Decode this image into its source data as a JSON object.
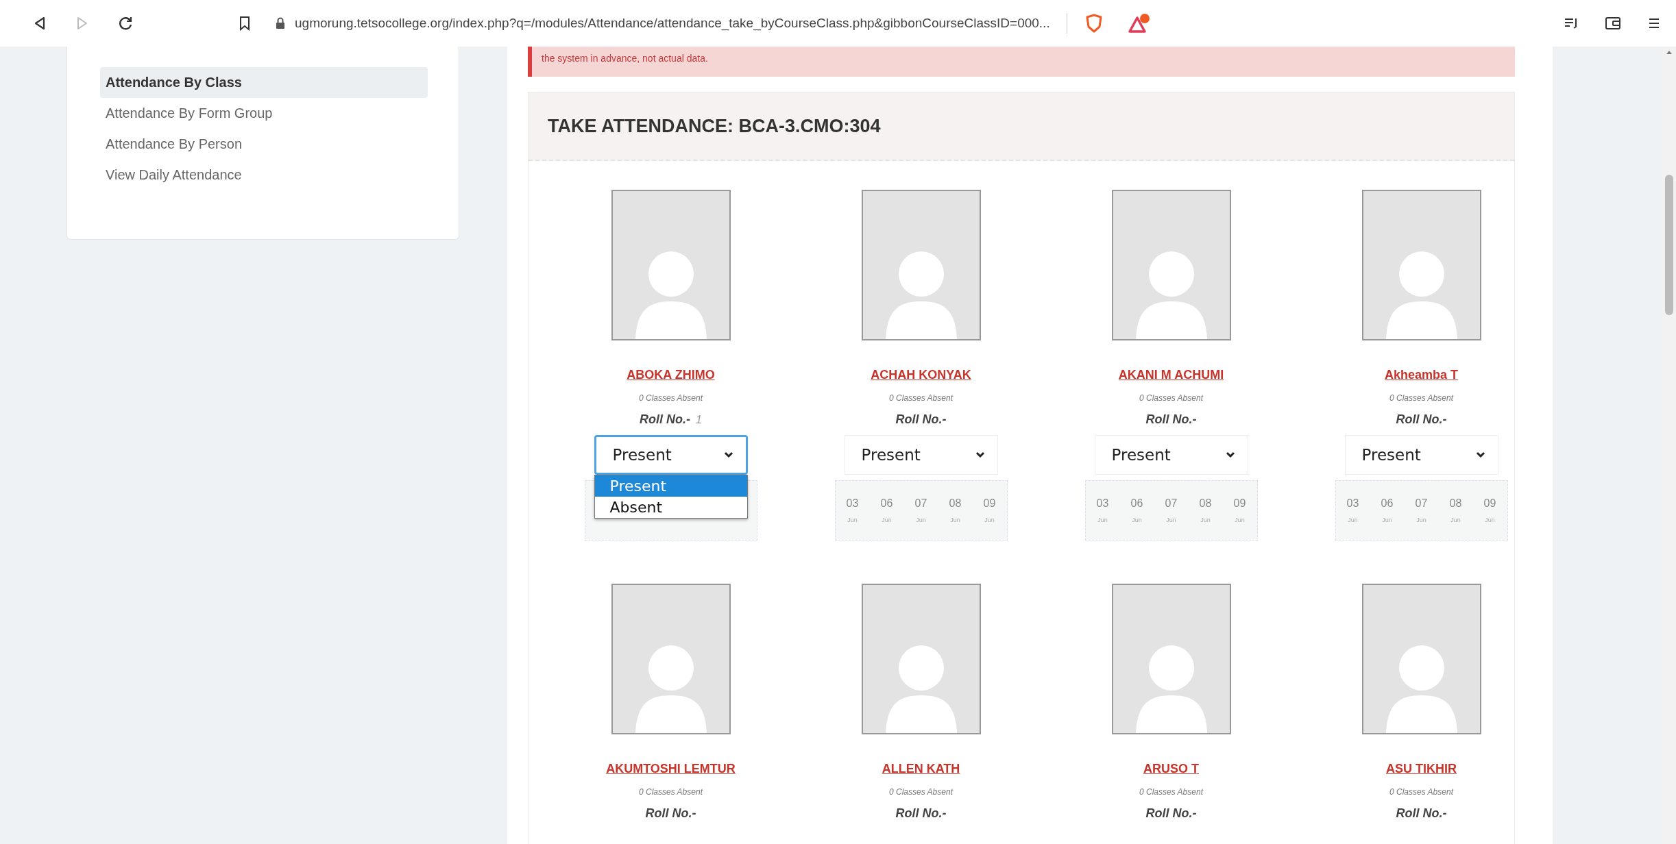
{
  "browser": {
    "url": "ugmorung.tetsocollege.org/index.php?q=/modules/Attendance/attendance_take_byCourseClass.php&gibbonCourseClassID=000..."
  },
  "sidebar": {
    "items": [
      {
        "label": "Attendance By Class",
        "selected": true
      },
      {
        "label": "Attendance By Form Group",
        "selected": false
      },
      {
        "label": "Attendance By Person",
        "selected": false
      },
      {
        "label": "View Daily Attendance",
        "selected": false
      }
    ]
  },
  "alert": {
    "text": "the system in advance, not actual data."
  },
  "attendance": {
    "title": "TAKE ATTENDANCE: BCA-3.CMO:304",
    "students": [
      {
        "name": "ABOKA ZHIMO",
        "absences": "0 Classes Absent",
        "roll_label": "Roll No.-",
        "roll_number": "1",
        "status": "Present",
        "dropdown": {
          "open": true,
          "options": [
            {
              "label": "Present",
              "selected": true
            },
            {
              "label": "Absent",
              "selected": false
            }
          ]
        }
      },
      {
        "name": "ACHAH KONYAK",
        "absences": "0 Classes Absent",
        "roll_label": "Roll No.-",
        "status": "Present",
        "dates": [
          {
            "day": "03",
            "month": "Jun"
          },
          {
            "day": "06",
            "month": "Jun"
          },
          {
            "day": "07",
            "month": "Jun"
          },
          {
            "day": "08",
            "month": "Jun"
          },
          {
            "day": "09",
            "month": "Jun"
          }
        ]
      },
      {
        "name": "AKANI M ACHUMI",
        "absences": "0 Classes Absent",
        "roll_label": "Roll No.-",
        "status": "Present",
        "dates": [
          {
            "day": "03",
            "month": "Jun"
          },
          {
            "day": "06",
            "month": "Jun"
          },
          {
            "day": "07",
            "month": "Jun"
          },
          {
            "day": "08",
            "month": "Jun"
          },
          {
            "day": "09",
            "month": "Jun"
          }
        ]
      },
      {
        "name": "Akheamba T",
        "absences": "0 Classes Absent",
        "roll_label": "Roll No.-",
        "status": "Present",
        "dates": [
          {
            "day": "03",
            "month": "Jun"
          },
          {
            "day": "06",
            "month": "Jun"
          },
          {
            "day": "07",
            "month": "Jun"
          },
          {
            "day": "08",
            "month": "Jun"
          },
          {
            "day": "09",
            "month": "Jun"
          }
        ]
      },
      {
        "name": "AKUMTOSHI LEMTUR",
        "absences": "0 Classes Absent",
        "roll_label": "Roll No.-"
      },
      {
        "name": "ALLEN KATH",
        "absences": "0 Classes Absent",
        "roll_label": "Roll No.-"
      },
      {
        "name": "ARUSO T",
        "absences": "0 Classes Absent",
        "roll_label": "Roll No.-"
      },
      {
        "name": "ASU TIKHIR",
        "absences": "0 Classes Absent",
        "roll_label": "Roll No.-"
      }
    ]
  }
}
